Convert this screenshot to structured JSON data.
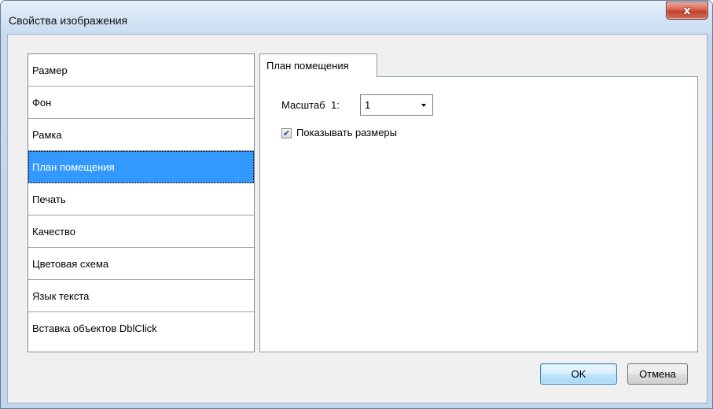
{
  "window": {
    "title": "Свойства изображения",
    "close_glyph": "x"
  },
  "sidebar": {
    "items": [
      {
        "label": "Размер"
      },
      {
        "label": "Фон"
      },
      {
        "label": "Рамка"
      },
      {
        "label": "План помещения",
        "selected": true
      },
      {
        "label": "Печать"
      },
      {
        "label": "Качество"
      },
      {
        "label": "Цветовая схема"
      },
      {
        "label": "Язык текста"
      },
      {
        "label": "Вставка объектов DblClick"
      }
    ]
  },
  "tab": {
    "label": "План помещения"
  },
  "panel": {
    "scale_label": "Масштаб",
    "scale_prefix": "1:",
    "scale_value": "1",
    "show_sizes_label": "Показывать размеры",
    "show_sizes_checked": true,
    "check_glyph": "✔"
  },
  "buttons": {
    "ok": "OK",
    "cancel": "Отмена"
  },
  "colors": {
    "selection": "#3399ff",
    "close_button": "#c0402a"
  }
}
